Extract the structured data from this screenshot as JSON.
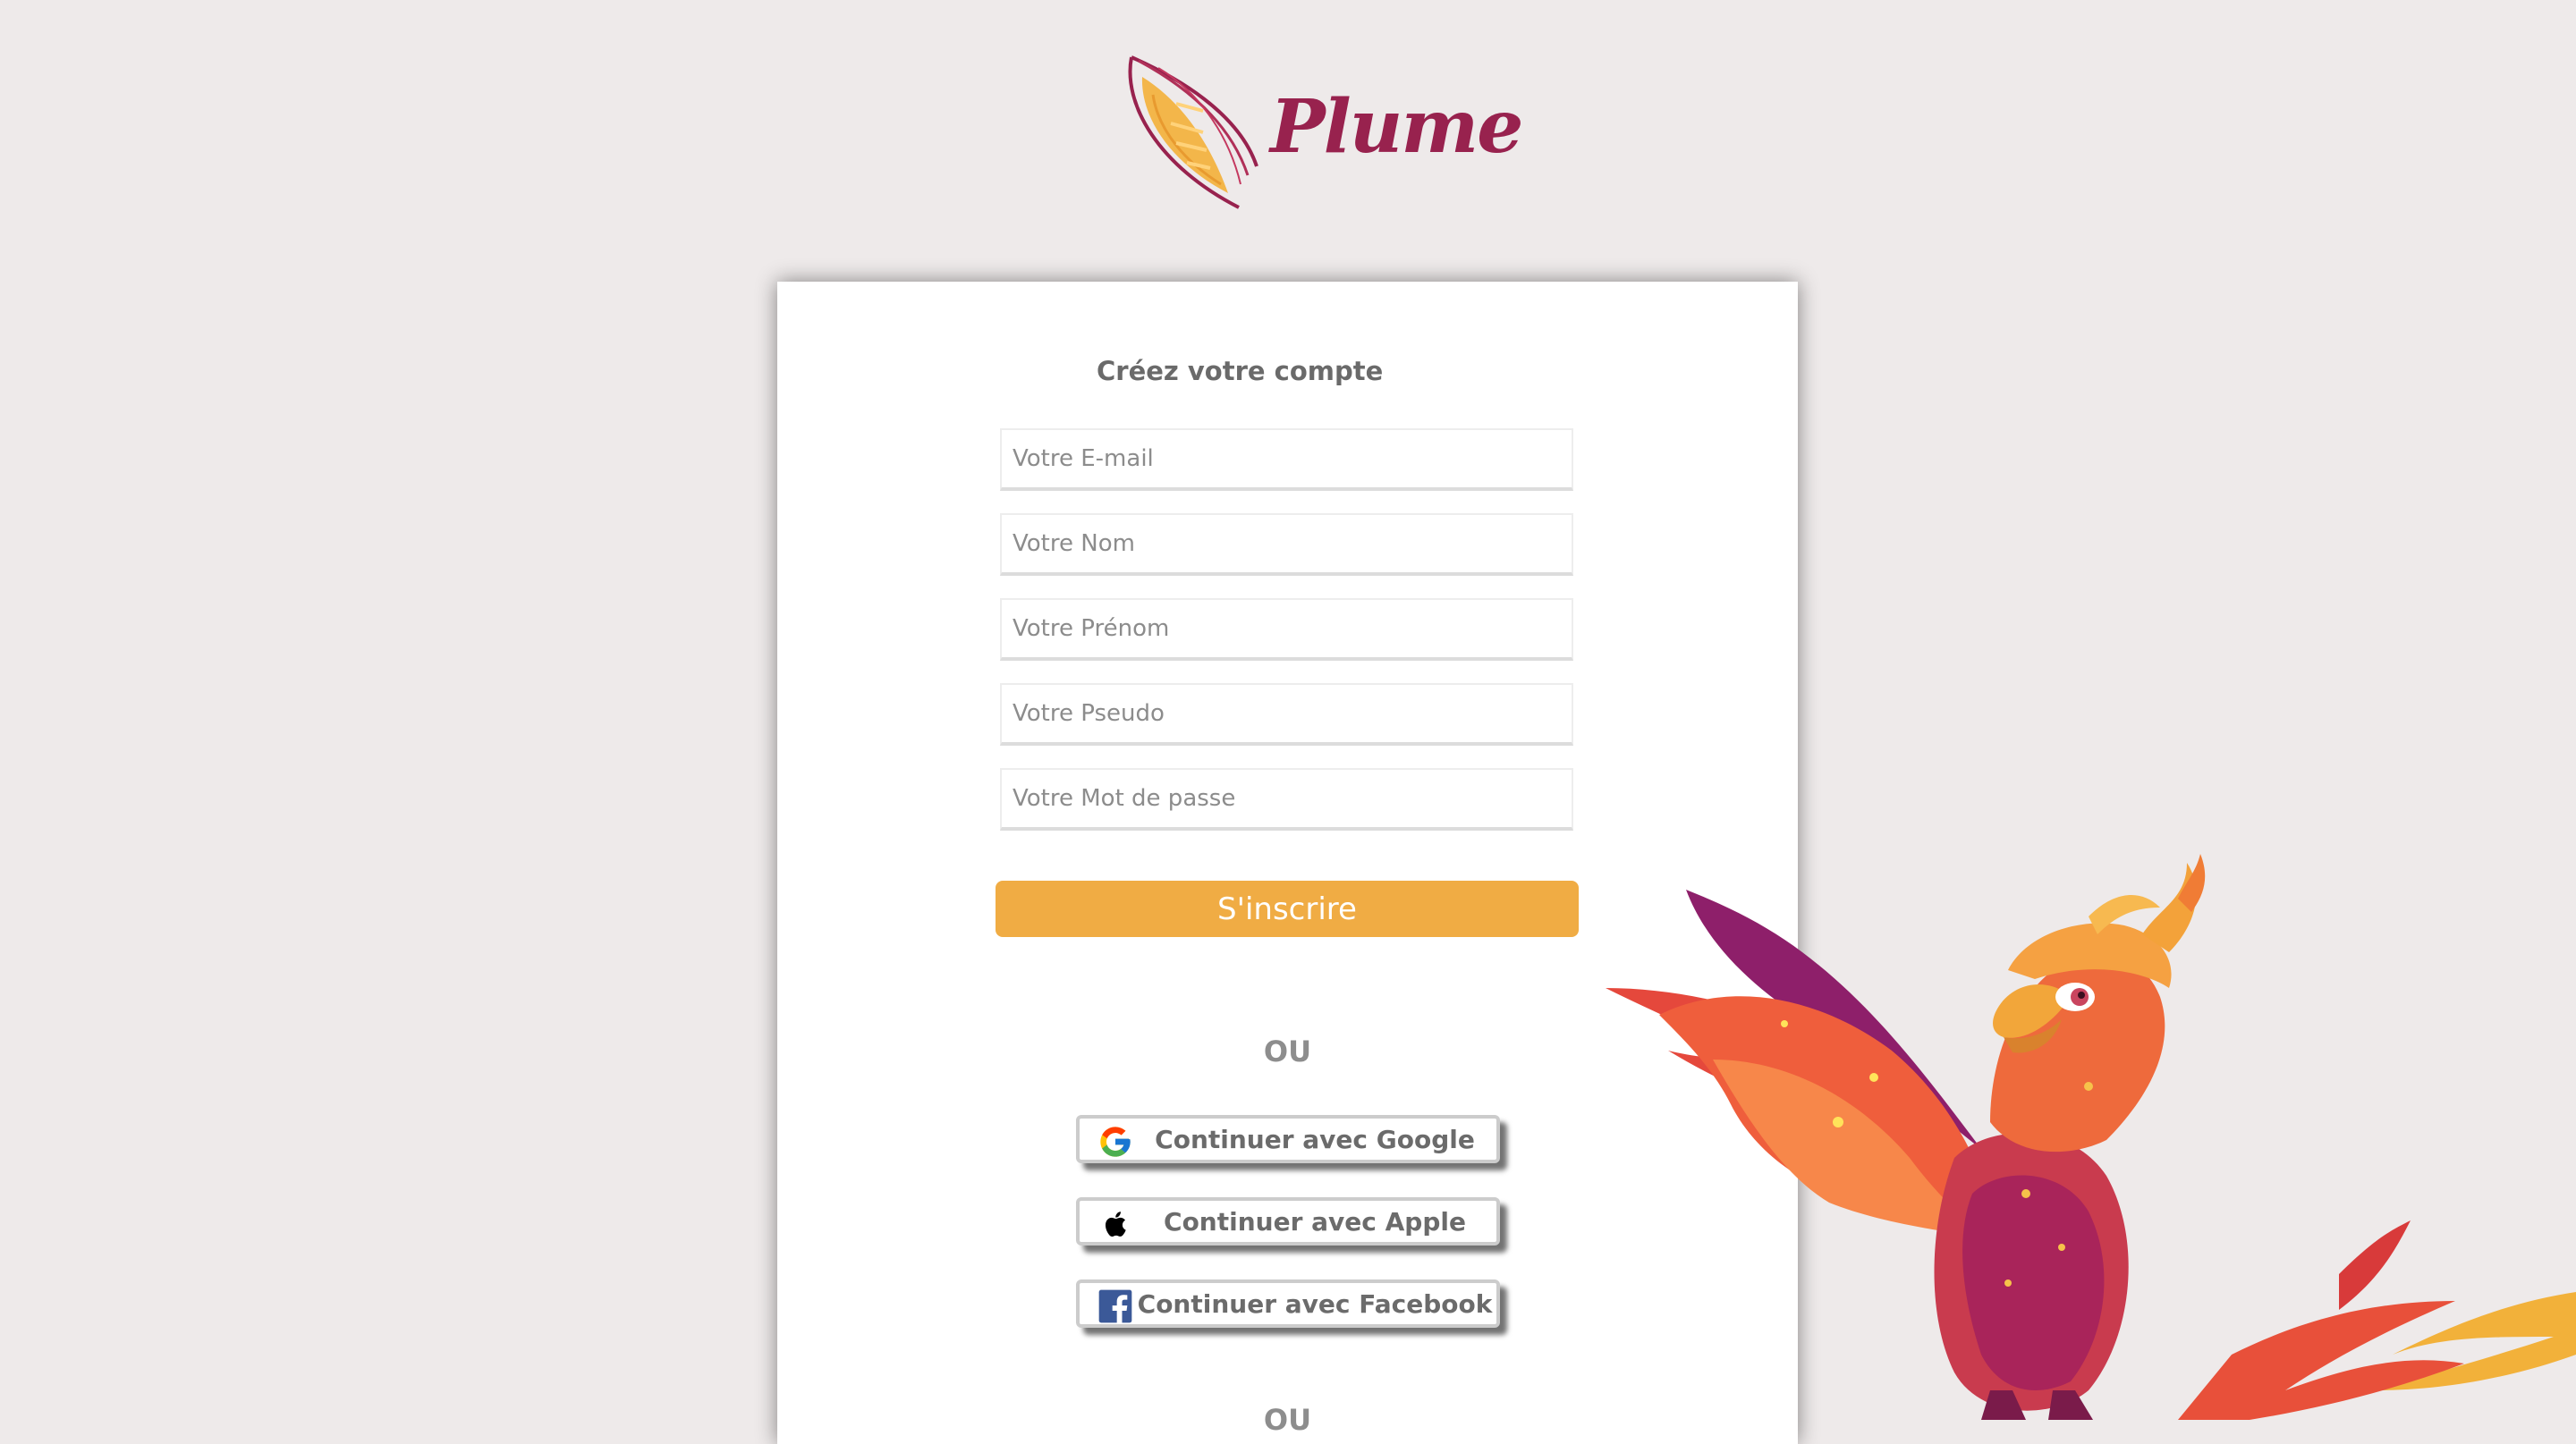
{
  "brand": {
    "name": "Plume",
    "logo_icon": "feather-icon",
    "color": "#98224e"
  },
  "signup": {
    "title": "Créez votre compte",
    "fields": {
      "email_placeholder": "Votre E-mail",
      "nom_placeholder": "Votre Nom",
      "prenom_placeholder": "Votre Prénom",
      "pseudo_placeholder": "Votre Pseudo",
      "password_placeholder": "Votre Mot de passe"
    },
    "submit_label": "S'inscrire",
    "submit_color": "#f0ac44"
  },
  "separator": {
    "label": "OU",
    "bottom_label": "OU"
  },
  "social": {
    "google": {
      "label": "Continuer avec Google",
      "icon": "google-icon"
    },
    "apple": {
      "label": "Continuer avec Apple",
      "icon": "apple-icon"
    },
    "facebook": {
      "label": "Continuer avec Facebook",
      "icon": "facebook-icon"
    }
  },
  "illustration": {
    "icon": "phoenix-illustration"
  },
  "colors": {
    "background": "#eeeaea",
    "card": "#ffffff",
    "accent": "#f0ac44",
    "brand": "#98224e"
  }
}
